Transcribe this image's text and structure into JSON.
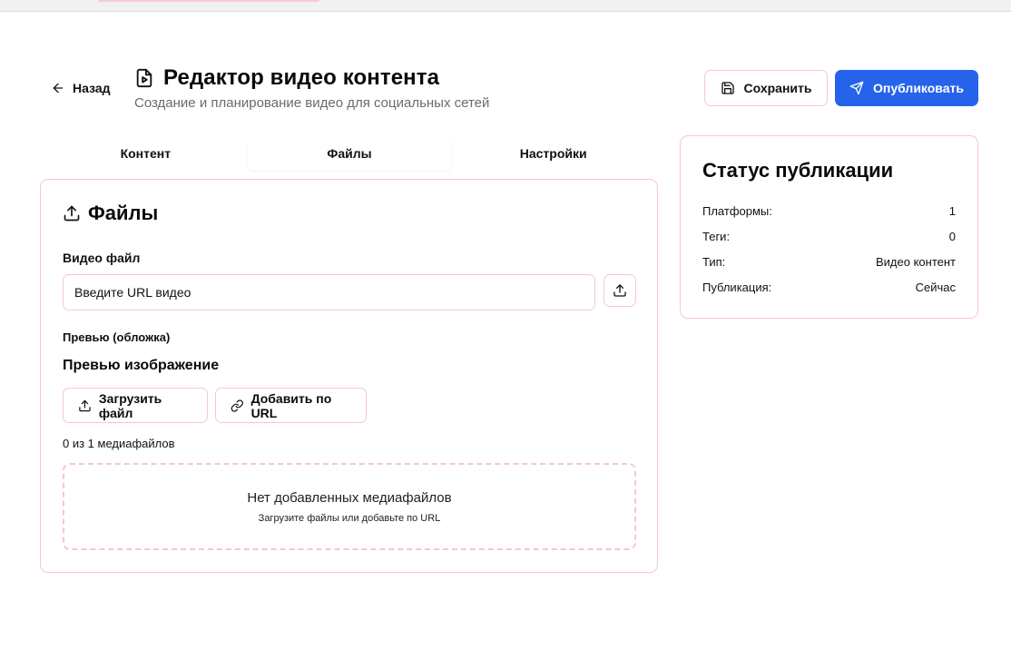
{
  "header": {
    "back_label": "Назад",
    "title": "Редактор видео контента",
    "subtitle": "Создание и планирование видео для социальных сетей",
    "save_label": "Сохранить",
    "publish_label": "Опубликовать"
  },
  "tabs": [
    {
      "label": "Контент",
      "active": false
    },
    {
      "label": "Файлы",
      "active": true
    },
    {
      "label": "Настройки",
      "active": false
    }
  ],
  "files": {
    "title": "Файлы",
    "video_label": "Видео файл",
    "video_placeholder": "Введите URL видео",
    "preview_label": "Превью (обложка)",
    "preview_heading": "Превью изображение",
    "upload_button": "Загрузить файл",
    "url_button": "Добавить по URL",
    "counter": "0 из 1 медиафайлов",
    "empty_title": "Нет добавленных медиафайлов",
    "empty_hint": "Загрузите файлы или добавьте по URL"
  },
  "status": {
    "title": "Статус публикации",
    "rows": [
      {
        "label": "Платформы:",
        "value": "1"
      },
      {
        "label": "Теги:",
        "value": "0"
      },
      {
        "label": "Тип:",
        "value": "Видео контент"
      },
      {
        "label": "Публикация:",
        "value": "Сейчас"
      }
    ]
  },
  "colors": {
    "accent": "#2563eb",
    "border": "#f5c6d2",
    "muted_text": "#6b6b6b"
  },
  "icons": [
    "arrow-left-icon",
    "video-file-icon",
    "save-icon",
    "send-icon",
    "upload-icon",
    "link-icon"
  ]
}
